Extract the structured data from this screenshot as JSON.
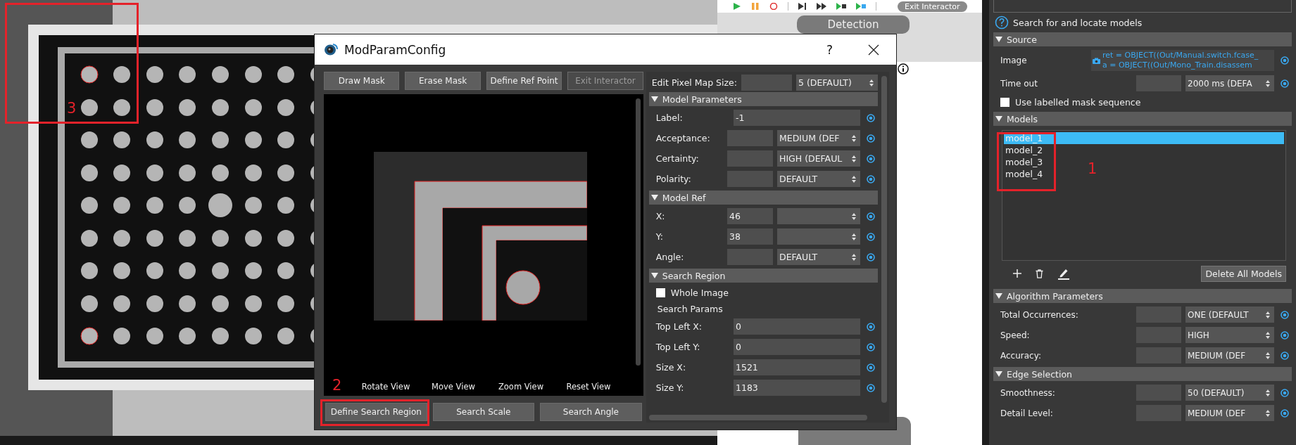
{
  "background_image": {
    "annotation": "3"
  },
  "flow_editor": {
    "toolbar_button": "Exit Interactor",
    "node": "Detection"
  },
  "dialog": {
    "title": "ModParamConfig",
    "help": "?",
    "annotation": "2",
    "tool_buttons": [
      {
        "label": "Draw Mask",
        "disabled": false
      },
      {
        "label": "Erase Mask",
        "disabled": false
      },
      {
        "label": "Define Ref Point",
        "disabled": false
      },
      {
        "label": "Exit Interactor",
        "disabled": true
      }
    ],
    "view_controls": [
      "Rotate View",
      "Move View",
      "Zoom View",
      "Reset View"
    ],
    "bottom_buttons": [
      "Define Search Region",
      "Search Scale",
      "Search Angle"
    ],
    "pixel_map": {
      "label": "Edit Pixel Map Size:",
      "option": "5 (DEFAULT)"
    },
    "sections": [
      {
        "title": "Model Parameters",
        "expanded": true,
        "rows": [
          {
            "kind": "text",
            "label": "Label:",
            "value": "-1"
          },
          {
            "kind": "combo",
            "label": "Acceptance:",
            "option": "MEDIUM (DEF"
          },
          {
            "kind": "combo",
            "label": "Certainty:",
            "option": "HIGH (DEFAUL"
          },
          {
            "kind": "combo",
            "label": "Polarity:",
            "option": "DEFAULT"
          }
        ]
      },
      {
        "title": "Model Ref",
        "expanded": true,
        "rows": [
          {
            "kind": "combo",
            "label": "X:",
            "value": "46"
          },
          {
            "kind": "combo",
            "label": "Y:",
            "value": "38"
          },
          {
            "kind": "combo",
            "label": "Angle:",
            "option": "DEFAULT"
          }
        ]
      },
      {
        "title": "Search Region",
        "expanded": true,
        "rows": [
          {
            "kind": "checkbox",
            "label": "Whole Image",
            "checked": false
          },
          {
            "kind": "heading",
            "label": "Search Params"
          },
          {
            "kind": "text",
            "label": "Top Left X:",
            "value": "0"
          },
          {
            "kind": "text",
            "label": "Top Left Y:",
            "value": "0"
          },
          {
            "kind": "text",
            "label": "Size X:",
            "value": "1521"
          },
          {
            "kind": "text",
            "label": "Size Y:",
            "value": "1183"
          }
        ]
      }
    ]
  },
  "properties": {
    "help_text": "Search for and locate models",
    "sections": [
      {
        "title": "Source",
        "expanded": true,
        "rows": [
          {
            "kind": "source",
            "label": "Image",
            "lines": [
              "ret = OBJECT((Out/Manual.switch.fcase_",
              "a = OBJECT((Out/Mono_Train.disassem"
            ]
          },
          {
            "kind": "combo",
            "label": "Time out",
            "option": "2000 ms (DEFA"
          },
          {
            "kind": "checkbox",
            "label": "Use labelled mask sequence",
            "checked": false
          }
        ]
      },
      {
        "title": "Models",
        "expanded": true
      },
      {
        "title": "Algorithm Parameters",
        "expanded": true,
        "rows": [
          {
            "kind": "combo",
            "label": "Total Occurrences:",
            "option": "ONE (DEFAULT"
          },
          {
            "kind": "combo",
            "label": "Speed:",
            "option": "HIGH"
          },
          {
            "kind": "combo",
            "label": "Accuracy:",
            "option": "MEDIUM (DEF"
          }
        ]
      },
      {
        "title": "Edge Selection",
        "expanded": true,
        "rows": [
          {
            "kind": "combo",
            "label": "Smoothness:",
            "option": "50 (DEFAULT)"
          },
          {
            "kind": "combo",
            "label": "Detail Level:",
            "option": "MEDIUM (DEF"
          }
        ]
      }
    ],
    "models": {
      "annotation": "1",
      "items": [
        {
          "label": "model_1",
          "selected": true
        },
        {
          "label": "model_2",
          "selected": false
        },
        {
          "label": "model_3",
          "selected": false
        },
        {
          "label": "model_4",
          "selected": false
        }
      ],
      "delete_all": "Delete All Models"
    }
  }
}
